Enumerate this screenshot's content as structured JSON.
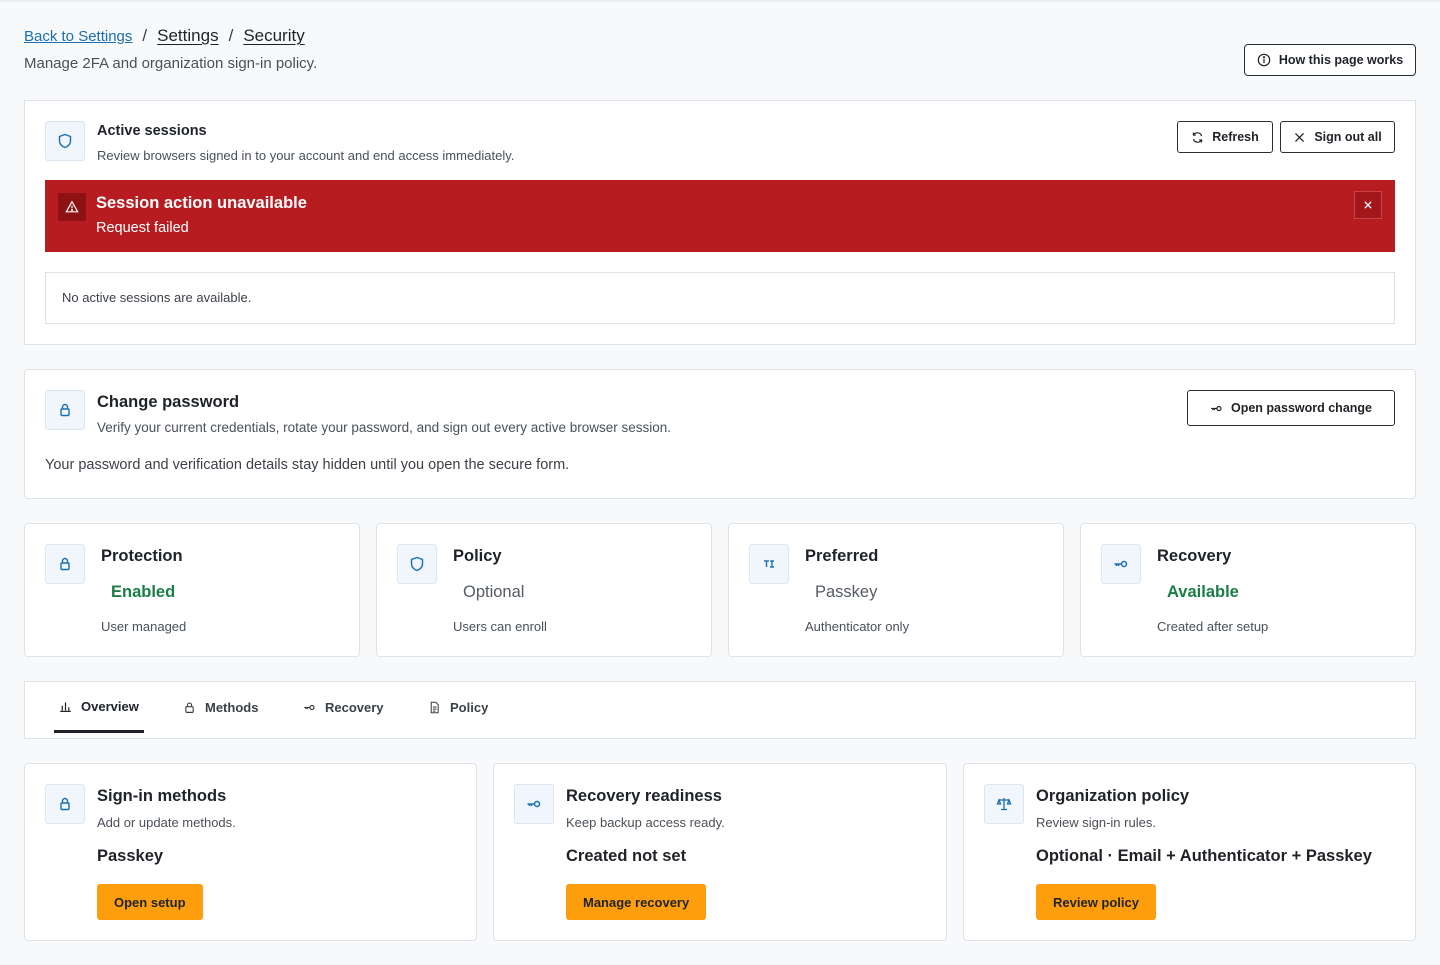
{
  "header": {
    "back_link": "Back to Settings",
    "separator": "/",
    "crumb_settings": "Settings",
    "crumb_security": "Security",
    "subtitle": "Manage 2FA and organization sign-in policy.",
    "help_button": "How this page works"
  },
  "sessions": {
    "icon": "shield-icon",
    "title": "Active sessions",
    "description": "Review browsers signed in to your account and end access immediately.",
    "refresh_label": "Refresh",
    "signout_label": "Sign out all",
    "alert": {
      "title": "Session action unavailable",
      "message": "Request failed",
      "color": "#b71c20"
    },
    "empty_text": "No active sessions are available."
  },
  "password": {
    "icon": "lock-icon",
    "title": "Change password",
    "description": "Verify your current credentials, rotate your password, and sign out every active browser session.",
    "button_label": "Open password change",
    "note": "Your password and verification details stay hidden until you open the secure form."
  },
  "stats": [
    {
      "icon": "lock-icon",
      "label": "Protection",
      "value": "Enabled",
      "value_color": "#1b7d46",
      "sub": "User managed"
    },
    {
      "icon": "shield-icon",
      "label": "Policy",
      "value": "Optional",
      "value_color": "#555b63",
      "sub": "Users can enroll"
    },
    {
      "icon": "passkey-icon",
      "label": "Preferred",
      "value": "Passkey",
      "value_color": "#555b63",
      "sub": "Authenticator only"
    },
    {
      "icon": "key-icon",
      "label": "Recovery",
      "value": "Available",
      "value_color": "#1b7d46",
      "sub": "Created after setup"
    }
  ],
  "tabs": [
    {
      "icon": "chart-icon",
      "label": "Overview",
      "active": true
    },
    {
      "icon": "lock-icon",
      "label": "Methods",
      "active": false
    },
    {
      "icon": "key-icon",
      "label": "Recovery",
      "active": false
    },
    {
      "icon": "document-icon",
      "label": "Policy",
      "active": false
    }
  ],
  "features": [
    {
      "icon": "lock-icon",
      "title": "Sign-in methods",
      "description": "Add or update methods.",
      "value": "Passkey",
      "button": "Open setup"
    },
    {
      "icon": "key-icon",
      "title": "Recovery readiness",
      "description": "Keep backup access ready.",
      "value": "Created not set",
      "button": "Manage recovery"
    },
    {
      "icon": "scale-icon",
      "title": "Organization policy",
      "description": "Review sign-in rules.",
      "value": "Optional · Email + Authenticator + Passkey",
      "button": "Review policy"
    }
  ],
  "colors": {
    "accent": "#1a6fb0",
    "primary_button": "#ff9e0d",
    "success": "#1b7d46",
    "danger": "#b71c20"
  }
}
